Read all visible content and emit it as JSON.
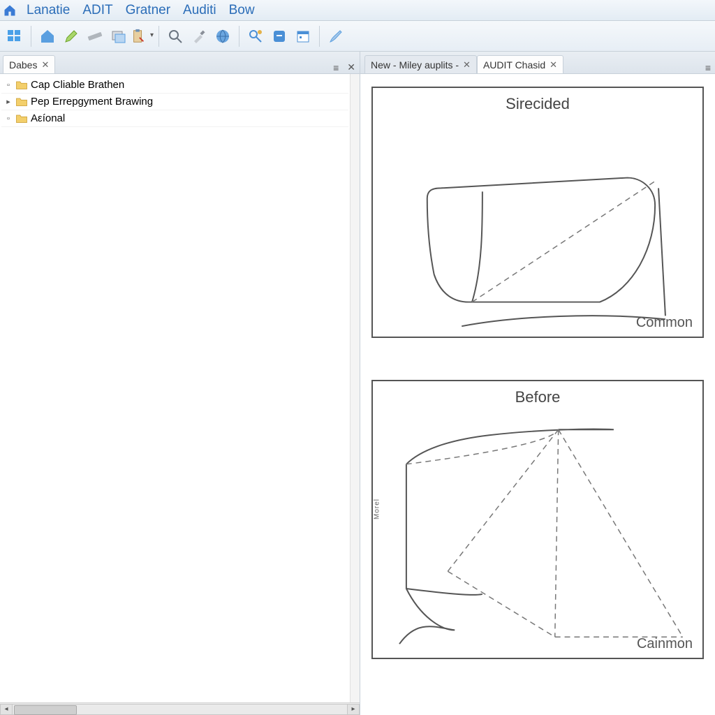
{
  "menu": {
    "items": [
      "Lanatie",
      "ADIT",
      "Gratner",
      "Auditi",
      "Bow"
    ]
  },
  "toolbar": {
    "icons": [
      "windows-icon",
      "separator",
      "home-icon",
      "pencil-icon",
      "ruler-icon",
      "layers-icon",
      "clipboard-icon",
      "separator",
      "zoom-icon",
      "eyedropper-icon",
      "globe-icon",
      "separator",
      "wrench-search-icon",
      "blue-square-icon",
      "calendar-icon",
      "separator",
      "brush-icon"
    ]
  },
  "left_panel": {
    "tab_label": "Dabes",
    "tree": [
      {
        "expander": "box",
        "label": "Cap Cliable Brathen"
      },
      {
        "expander": "arrow",
        "label": "Pep Errepgyment Brawing"
      },
      {
        "expander": "box",
        "label": "Aεíonal"
      }
    ]
  },
  "right_panel": {
    "tabs": [
      {
        "label": "New - Miley auplits -",
        "active": false
      },
      {
        "label": "AUDIT Chasid",
        "active": true
      }
    ],
    "figures": [
      {
        "title": "Sirecided",
        "footer": "Common",
        "side": ""
      },
      {
        "title": "Before",
        "footer": "Cainmon",
        "side": "Mоrel"
      }
    ]
  }
}
